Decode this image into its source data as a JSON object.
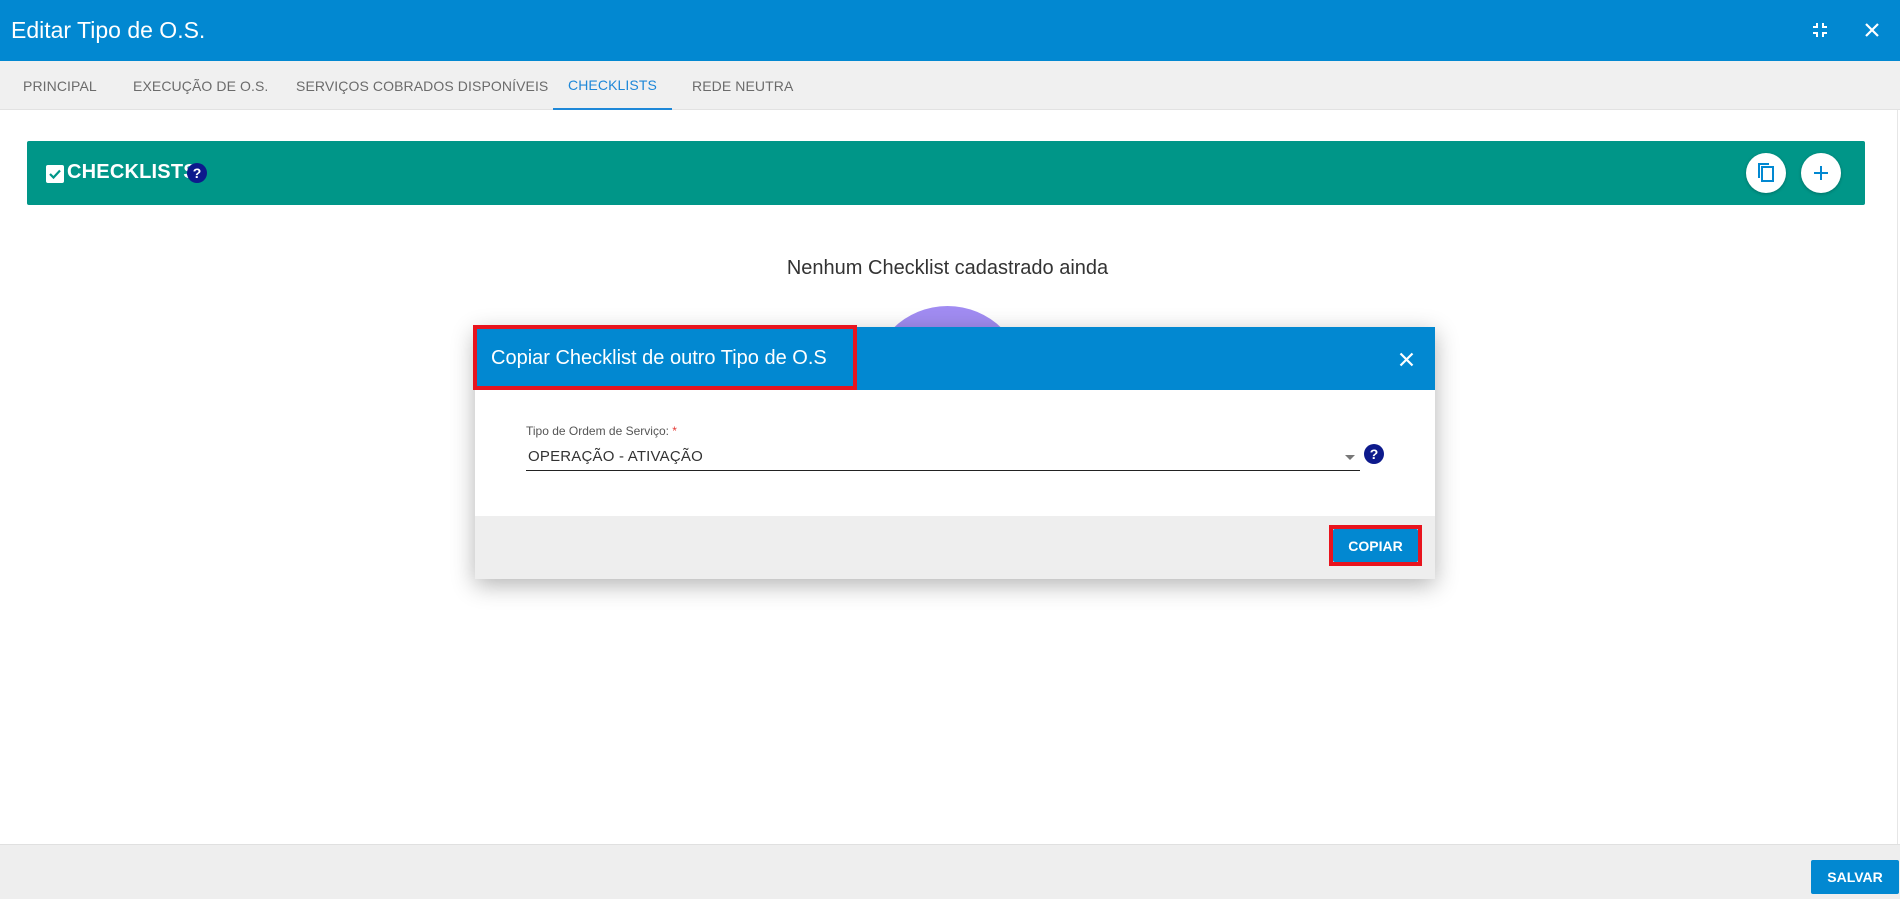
{
  "window": {
    "title": "Editar Tipo de O.S.",
    "minimize_icon": "collapse-icon",
    "close_icon": "close-icon"
  },
  "tabs": [
    {
      "label": "PRINCIPAL",
      "active": false
    },
    {
      "label": "EXECUÇÃO DE O.S.",
      "active": false
    },
    {
      "label": "SERVIÇOS COBRADOS DISPONÍVEIS",
      "active": false
    },
    {
      "label": "CHECKLISTS",
      "active": true
    },
    {
      "label": "REDE NEUTRA",
      "active": false
    }
  ],
  "section": {
    "title": "CHECKLISTS",
    "help": "?",
    "icons": [
      "checkbox-icon",
      "help-icon",
      "copy-icon",
      "add-icon"
    ]
  },
  "empty_state": {
    "message": "Nenhum Checklist cadastrado ainda"
  },
  "dialog": {
    "title": "Copiar Checklist de outro Tipo de O.S",
    "field_label": "Tipo de Ordem de Serviço:",
    "required_mark": "*",
    "selected_value": "OPERAÇÃO - ATIVAÇÃO",
    "help": "?",
    "copy_label": "COPIAR"
  },
  "footer": {
    "save_label": "SALVAR"
  },
  "colors": {
    "primary": "#0288d1",
    "section_bar": "#009688",
    "highlight": "#e8141e",
    "help_icon": "#0d1a8c"
  }
}
